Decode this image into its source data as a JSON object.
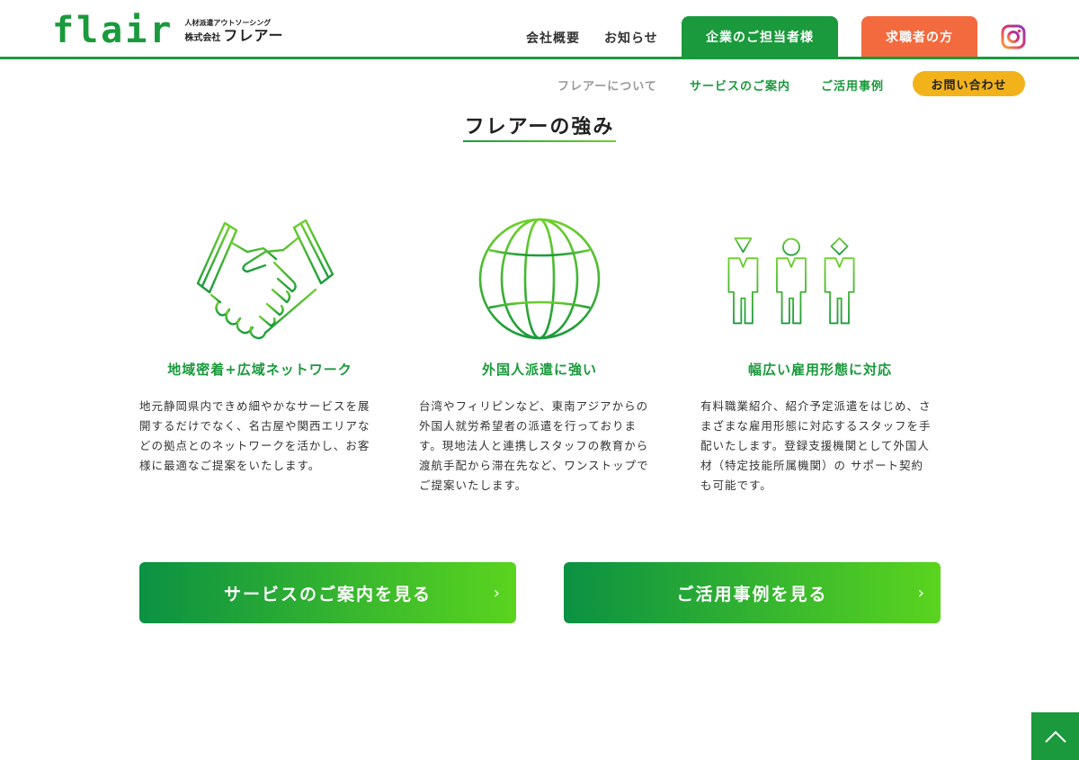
{
  "header": {
    "logo_mark": "flair",
    "logo_tagline": "人材派遣アウトソーシング",
    "logo_company_prefix": "株式会社",
    "logo_company_name": "フレアー",
    "nav": {
      "about_company": "会社概要",
      "news": "お知らせ",
      "corporate_button": "企業のご担当者様",
      "jobseeker_button": "求職者の方",
      "instagram_icon": "instagram-icon"
    }
  },
  "subnav": {
    "about": "フレアーについて",
    "service": "サービスのご案内",
    "cases": "ご活用事例",
    "contact": "お問い合わせ"
  },
  "section": {
    "title": "フレアーの強み"
  },
  "features": [
    {
      "icon": "handshake-icon",
      "title": "地域密着+広域ネットワーク",
      "description": "地元静岡県内できめ細やかなサービスを展開するだけでなく、名古屋や関西エリアなどの拠点とのネットワークを活かし、お客様に最適なご提案をいたします。"
    },
    {
      "icon": "globe-icon",
      "title": "外国人派遣に強い",
      "description": "台湾やフィリピンなど、東南アジアからの外国人就労希望者の派遣を行っております。現地法人と連携しスタッフの教育から渡航手配から滞在先など、ワンストップでご提案いたします。"
    },
    {
      "icon": "people-icon",
      "title": "幅広い雇用形態に対応",
      "description": "有料職業紹介、紹介予定派遣をはじめ、さまざまな雇用形態に対応するスタッフを手配いたします。登録支援機関として外国人材（特定技能所属機関）の サポート契約も可能です。"
    }
  ],
  "cta": {
    "service": "サービスのご案内を見る",
    "cases": "ご活用事例を見る",
    "arrow": "›"
  },
  "colors": {
    "brand_green": "#1a9a3c",
    "accent_orange": "#f36a3f",
    "accent_yellow": "#f2b21a"
  }
}
